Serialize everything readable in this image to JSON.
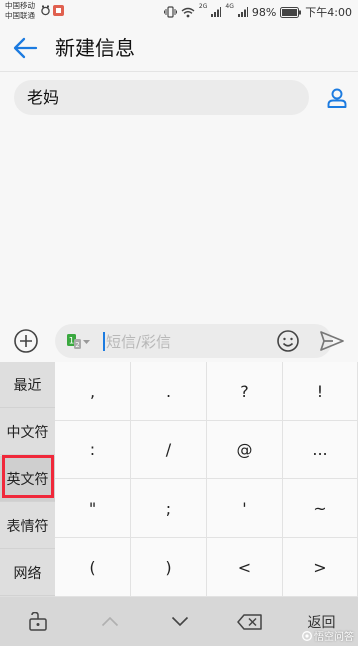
{
  "status_bar": {
    "carrier_1": "中国移动",
    "carrier_2": "中国联通",
    "net_1": "2G",
    "net_2": "4G",
    "battery": "98%",
    "time": "下午4:00"
  },
  "app_bar": {
    "title": "新建信息"
  },
  "recipient": {
    "name": "老妈"
  },
  "compose": {
    "placeholder": "短信/彩信",
    "sim_label_1": "1",
    "sim_label_2": "2"
  },
  "keyboard": {
    "categories": [
      "最近",
      "中文符",
      "英文符",
      "表情符",
      "网络"
    ],
    "active_category_index": 2,
    "symbols": [
      [
        ",",
        ".",
        "?",
        "!"
      ],
      [
        ":",
        "/",
        "@",
        "..."
      ],
      [
        "\"",
        ";",
        "'",
        "~"
      ],
      [
        "(",
        ")",
        "<",
        ">"
      ]
    ],
    "return_label": "返回"
  },
  "watermark": {
    "text": "悟空问答"
  },
  "colors": {
    "accent": "#1c7be0",
    "highlight": "#f0283a",
    "sim_green": "#3aa83f"
  }
}
